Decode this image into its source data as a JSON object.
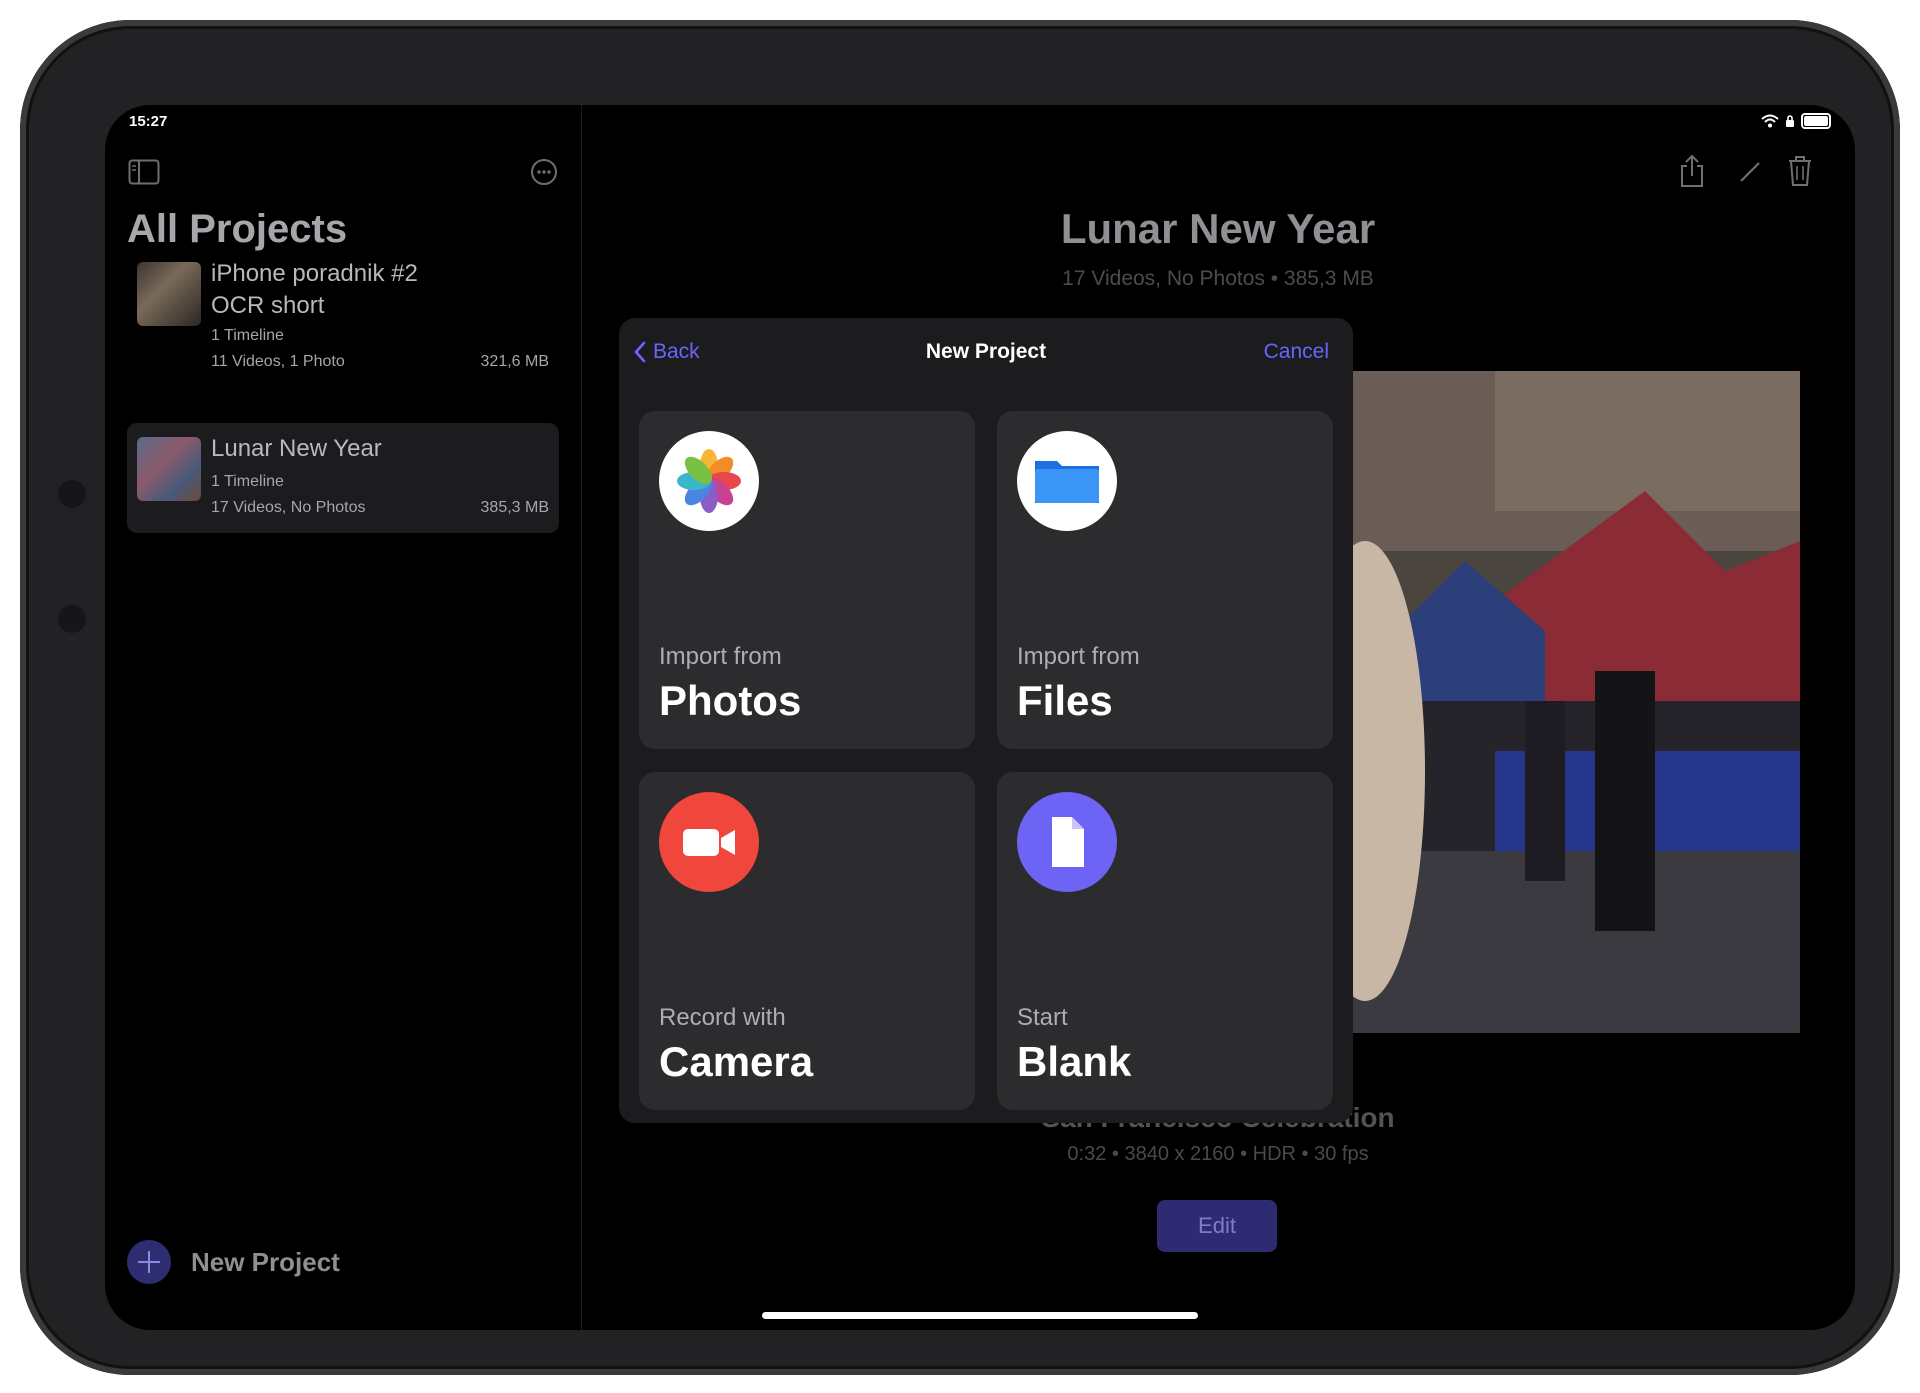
{
  "status": {
    "time": "15:27"
  },
  "sidebar": {
    "title": "All Projects",
    "projects": [
      {
        "name_line1": "iPhone poradnik #2",
        "name_line2": "OCR short",
        "timelines": "1 Timeline",
        "media": "11 Videos, 1 Photo",
        "size": "321,6 MB"
      },
      {
        "name_line1": "Lunar New Year",
        "timelines": "1 Timeline",
        "media": "17 Videos, No Photos",
        "size": "385,3 MB"
      }
    ],
    "new_project_label": "New Project"
  },
  "main": {
    "title": "Lunar New Year",
    "subtitle": "17 Videos, No Photos • 385,3 MB",
    "clip_title": "San Francisco Celebration",
    "clip_meta": "0:32 • 3840 x 2160 • HDR • 30 fps",
    "edit_label": "Edit"
  },
  "modal": {
    "back_label": "Back",
    "title": "New Project",
    "cancel_label": "Cancel",
    "cards": [
      {
        "sub": "Import from",
        "main": "Photos",
        "icon": "photos-icon"
      },
      {
        "sub": "Import from",
        "main": "Files",
        "icon": "files-icon"
      },
      {
        "sub": "Record with",
        "main": "Camera",
        "icon": "camera-icon"
      },
      {
        "sub": "Start",
        "main": "Blank",
        "icon": "document-icon"
      }
    ]
  },
  "colors": {
    "accent": "#6b64ff",
    "camera_red": "#f0463c",
    "blank_purple": "#6d63f5",
    "files_blue": "#2f8cf6"
  }
}
